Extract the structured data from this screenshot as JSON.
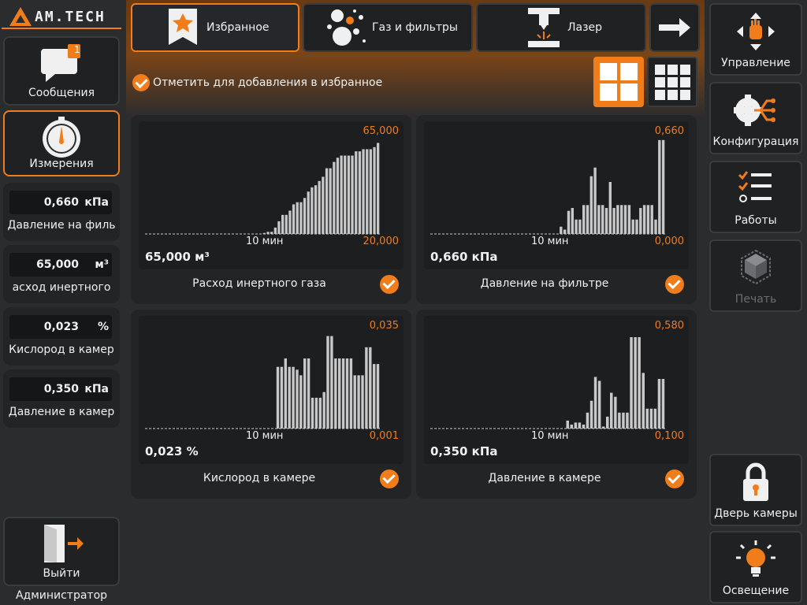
{
  "brand": {
    "logo_text": "AM.TECH"
  },
  "left_nav": {
    "messages": {
      "label": "Сообщения",
      "badge": "1"
    },
    "measurements": {
      "label": "Измерения"
    },
    "logout": {
      "label": "Выйти"
    },
    "user": "Администратор"
  },
  "measurements": [
    {
      "value": "0,660",
      "unit": "кПа",
      "name": "Давление на филь"
    },
    {
      "value": "65,000",
      "unit": "м³",
      "name": "асход инертного"
    },
    {
      "value": "0,023",
      "unit": "%",
      "name": "Кислород в камер"
    },
    {
      "value": "0,350",
      "unit": "кПа",
      "name": "Давление в камер"
    }
  ],
  "tabs": [
    {
      "label": "Избранное",
      "icon": "star-bookmark-icon",
      "active": true
    },
    {
      "label": "Газ и фильтры",
      "icon": "gas-bubbles-icon",
      "active": false
    },
    {
      "label": "Лазер",
      "icon": "laser-icon",
      "active": false
    }
  ],
  "favorites_toggle": {
    "label": "Отметить для добавления в избранное",
    "checked": true
  },
  "layout": {
    "options": [
      "grid-2x2-icon",
      "grid-3x3-icon"
    ],
    "selected": "grid-2x2-icon"
  },
  "cards": [
    {
      "title": "Расход инертного газа",
      "current": "65,000 м³",
      "ymax_label": "65,000",
      "ymin_label": "20,000",
      "x_tick": "10 мин",
      "checked": true,
      "chart_data": {
        "type": "bar",
        "ylim": [
          20,
          65
        ],
        "values": [
          20,
          20,
          20,
          20,
          20,
          20,
          20,
          20,
          20,
          20,
          20,
          20,
          20,
          20,
          20,
          20,
          20,
          20,
          20,
          20,
          20,
          20,
          20,
          20,
          20,
          20,
          20,
          20,
          20,
          20,
          20,
          20,
          20.5,
          21,
          21,
          23,
          26,
          29,
          29,
          31,
          34,
          35,
          35,
          37,
          40,
          42,
          43,
          45,
          47,
          51,
          51,
          54,
          56,
          57,
          57,
          57,
          57,
          59,
          59,
          60,
          60,
          60,
          61,
          63
        ]
      }
    },
    {
      "title": "Давление на фильтре",
      "current": "0,660 кПа",
      "ymax_label": "0,660",
      "ymin_label": "0,000",
      "x_tick": "10 мин",
      "checked": true,
      "chart_data": {
        "type": "bar",
        "ylim": [
          0,
          0.66
        ],
        "values": [
          0,
          0,
          0,
          0,
          0,
          0,
          0,
          0,
          0,
          0,
          0,
          0,
          0,
          0,
          0,
          0,
          0,
          0,
          0,
          0,
          0,
          0,
          0,
          0,
          0,
          0,
          0,
          0,
          0,
          0,
          0,
          0,
          0,
          0,
          0.05,
          0.03,
          0.16,
          0.18,
          0.1,
          0.1,
          0.2,
          0.2,
          0.4,
          0.46,
          0.2,
          0.2,
          0.18,
          0.36,
          0.18,
          0.2,
          0.2,
          0.2,
          0.2,
          0.1,
          0.1,
          0.18,
          0.2,
          0.2,
          0.2,
          0.1,
          0.65,
          0.65
        ]
      }
    },
    {
      "title": "Кислород в камере",
      "current": "0,023 %",
      "ymax_label": "0,035",
      "ymin_label": "0,001",
      "x_tick": "10 мин",
      "checked": true,
      "chart_data": {
        "type": "bar",
        "ylim": [
          0.001,
          0.035
        ],
        "values": [
          0.001,
          0.001,
          0.001,
          0.001,
          0.001,
          0.001,
          0.001,
          0.001,
          0.001,
          0.001,
          0.001,
          0.001,
          0.001,
          0.001,
          0.001,
          0.001,
          0.001,
          0.001,
          0.001,
          0.001,
          0.001,
          0.001,
          0.001,
          0.001,
          0.001,
          0.001,
          0.001,
          0.001,
          0.001,
          0.001,
          0.001,
          0.001,
          0.001,
          0.001,
          0.023,
          0.023,
          0.026,
          0.023,
          0.023,
          0.022,
          0.02,
          0.026,
          0.026,
          0.012,
          0.012,
          0.012,
          0.014,
          0.034,
          0.034,
          0.026,
          0.026,
          0.026,
          0.026,
          0.026,
          0.02,
          0.02,
          0.02,
          0.03,
          0.03,
          0.024,
          0.024
        ]
      }
    },
    {
      "title": "Давление в камере",
      "current": "0,350 кПа",
      "ymax_label": "0,580",
      "ymin_label": "0,100",
      "x_tick": "10 мин",
      "checked": true,
      "chart_data": {
        "type": "bar",
        "ylim": [
          0.1,
          0.58
        ],
        "values": [
          0.1,
          0.1,
          0.1,
          0.1,
          0.1,
          0.1,
          0.1,
          0.1,
          0.1,
          0.1,
          0.1,
          0.1,
          0.1,
          0.1,
          0.1,
          0.1,
          0.1,
          0.1,
          0.1,
          0.1,
          0.1,
          0.1,
          0.1,
          0.1,
          0.1,
          0.1,
          0.1,
          0.1,
          0.1,
          0.1,
          0.1,
          0.1,
          0.1,
          0.1,
          0.14,
          0.12,
          0.13,
          0.13,
          0.12,
          0.18,
          0.24,
          0.36,
          0.34,
          0.11,
          0.16,
          0.28,
          0.26,
          0.18,
          0.18,
          0.18,
          0.56,
          0.56,
          0.56,
          0.38,
          0.2,
          0.2,
          0.2,
          0.35,
          0.35
        ]
      }
    }
  ],
  "right_nav": {
    "control": {
      "label": "Управление"
    },
    "config": {
      "label": "Конфигурация"
    },
    "jobs": {
      "label": "Работы"
    },
    "print": {
      "label": "Печать",
      "disabled": true
    },
    "door": {
      "label": "Дверь камеры"
    },
    "light": {
      "label": "Освещение"
    }
  },
  "colors": {
    "accent": "#f07c1a",
    "bar": "#c8c8c8",
    "panel": "#232426",
    "bg": "#2b2c2e"
  }
}
